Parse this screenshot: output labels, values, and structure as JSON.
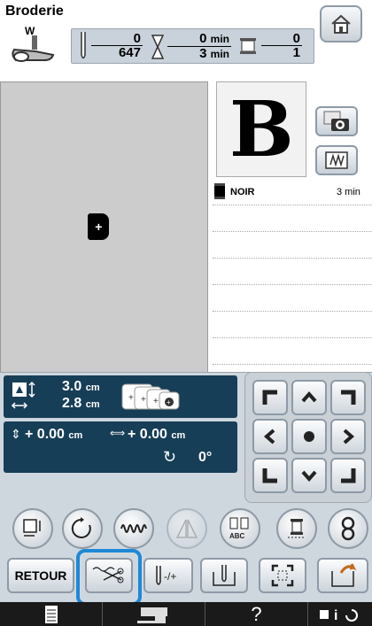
{
  "header": {
    "title": "Broderie",
    "presser_foot_label": "W"
  },
  "stitch_status": {
    "stitch_current": "0",
    "stitch_total": "647",
    "time_current": "0",
    "time_total": "3",
    "time_unit": "min",
    "color_current": "0",
    "color_total": "1"
  },
  "preview": {
    "glyph": "B"
  },
  "thread_list": [
    {
      "name": "NOIR",
      "time": "3 min",
      "color": "#000000"
    }
  ],
  "size": {
    "width": "3.0",
    "height": "2.8",
    "unit": "cm"
  },
  "position": {
    "x": "+ 0.00",
    "y": "+ 0.00",
    "unit": "cm",
    "rotation": "0°"
  },
  "buttons": {
    "back_label": "RETOUR",
    "help_label": "?"
  },
  "colors": {
    "panel": "#cfd7de",
    "dark_bar": "#173e57",
    "highlight": "#1f88d6"
  }
}
